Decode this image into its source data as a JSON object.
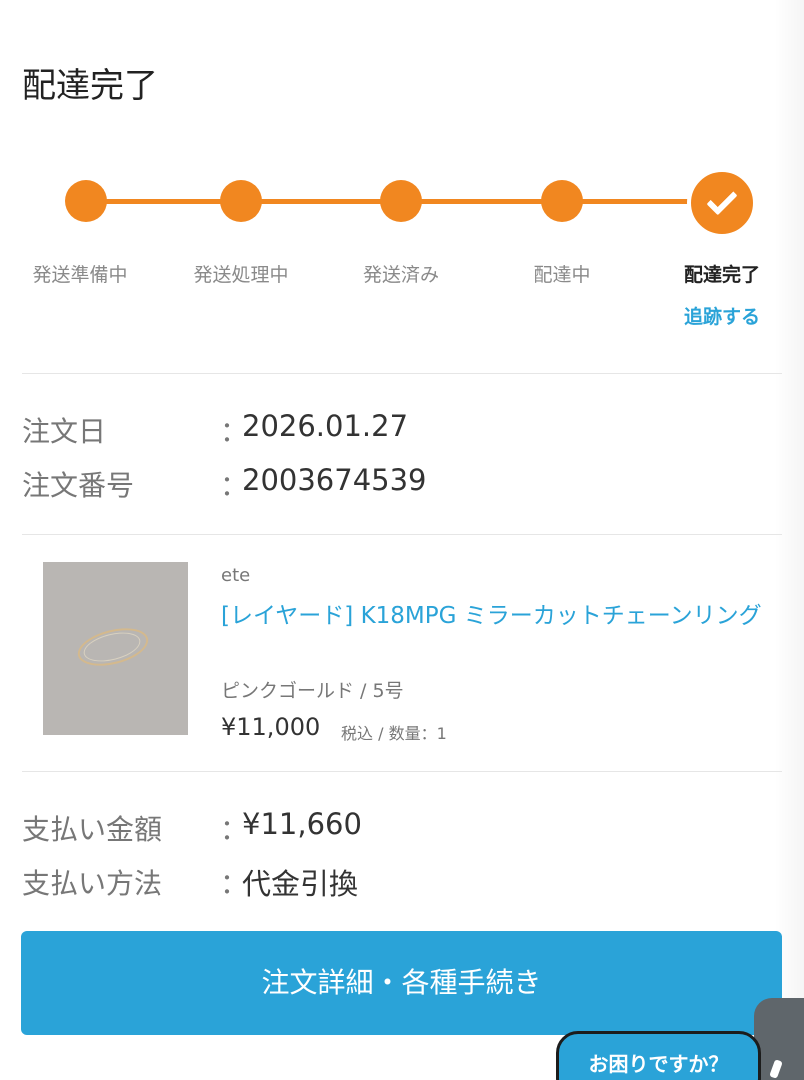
{
  "header": {
    "title": "配達完了"
  },
  "progress": {
    "steps": [
      {
        "label": "発送準備中"
      },
      {
        "label": "発送処理中"
      },
      {
        "label": "発送済み"
      },
      {
        "label": "配達中"
      },
      {
        "label": "配達完了"
      }
    ],
    "current_step_index": 4,
    "track_label": "追跡する",
    "accent_color": "#f18720"
  },
  "order_info": {
    "date_label": "注文日",
    "date_value": "2026.01.27",
    "number_label": "注文番号",
    "number_value": "2003674539",
    "separator": "："
  },
  "product": {
    "brand": "ete",
    "name": "[レイヤード] K18MPG ミラーカットチェーンリング",
    "variant": "ピンクゴールド / 5号",
    "price": "¥11,000",
    "price_meta": "税込 / 数量：1",
    "image_icon": "ring-photo"
  },
  "payment": {
    "amount_label": "支払い金額",
    "amount_value": "¥11,660",
    "method_label": "支払い方法",
    "method_value": "代金引換"
  },
  "actions": {
    "order_details_label": "注文詳細・各種手続き",
    "link_color": "#2aa3d8"
  },
  "help": {
    "bubble_label": "お困りですか？"
  }
}
